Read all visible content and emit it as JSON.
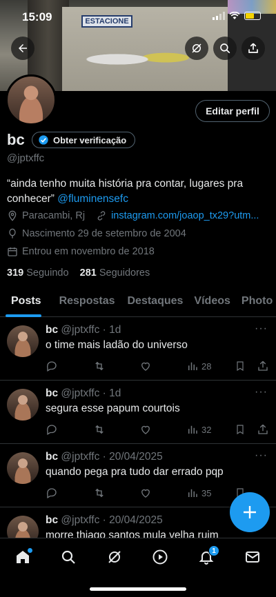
{
  "status_bar": {
    "time": "15:09"
  },
  "banner": {
    "sign_text": "ESTACIONE"
  },
  "profile": {
    "edit_button": "Editar perfil",
    "display_name": "bc",
    "verify_label": "Obter verificação",
    "handle": "@jptxffc",
    "bio_text": "“ainda tenho muita história pra contar, lugares pra conhecer” ",
    "bio_mention": "@fluminensefc",
    "location": "Paracambi, Rj",
    "website": "instagram.com/joaop_tx29?utm...",
    "birth": "Nascimento 29 de setembro de 2004",
    "joined": "Entrou em novembro de 2018",
    "following_count": "319",
    "following_label": "Seguindo",
    "followers_count": "281",
    "followers_label": "Seguidores"
  },
  "tabs": [
    {
      "label": "Posts"
    },
    {
      "label": "Respostas"
    },
    {
      "label": "Destaques"
    },
    {
      "label": "Vídeos"
    },
    {
      "label": "Photo"
    }
  ],
  "posts": [
    {
      "name": "bc",
      "meta": "@jptxffc · 1d",
      "text": "o time mais ladão do universo",
      "views": "28"
    },
    {
      "name": "bc",
      "meta": "@jptxffc · 1d",
      "text": "segura esse papum courtois",
      "views": "32"
    },
    {
      "name": "bc",
      "meta": "@jptxffc · 20/04/2025",
      "text": "quando pega pra tudo dar errado pqp",
      "views": "35"
    },
    {
      "name": "bc",
      "meta": "@jptxffc · 20/04/2025",
      "text": "morre thiago santos mula velha ruim",
      "views": ""
    }
  ],
  "nav": {
    "notifications_badge": "1"
  },
  "colors": {
    "accent": "#1d9bf0",
    "background": "#000000",
    "muted": "#71767b",
    "text": "#e7e9ea"
  }
}
